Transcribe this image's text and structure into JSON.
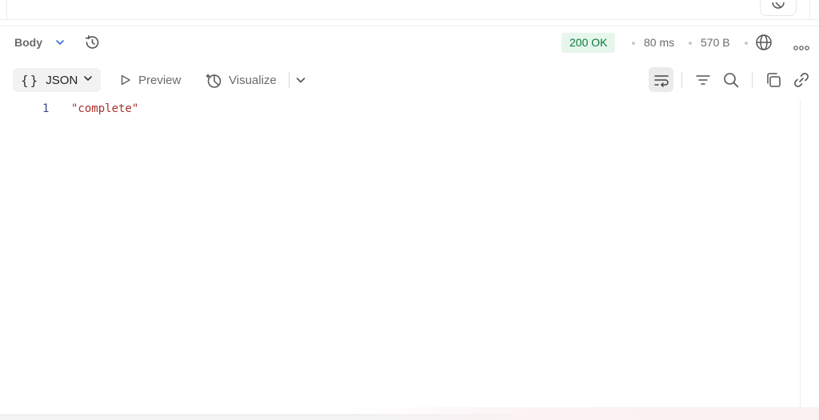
{
  "response": {
    "body_tab_label": "Body",
    "status": "200 OK",
    "time": "80 ms",
    "size": "570 B"
  },
  "toolbar": {
    "format_label": "JSON",
    "preview_label": "Preview",
    "visualize_label": "Visualize"
  },
  "editor": {
    "lines": [
      {
        "number": "1",
        "text": "\"complete\""
      }
    ]
  },
  "icons": {
    "history": "history-icon",
    "globe": "globe-icon",
    "more": "more-horizontal-icon",
    "wrap": "word-wrap-icon",
    "filter": "filter-icon",
    "search": "search-icon",
    "copy": "copy-icon",
    "link": "link-icon"
  },
  "colors": {
    "status_bg": "#e7f6ec",
    "status_text": "#0b7a3b",
    "string_value": "#a8322d",
    "line_number": "#3b4a8a"
  }
}
